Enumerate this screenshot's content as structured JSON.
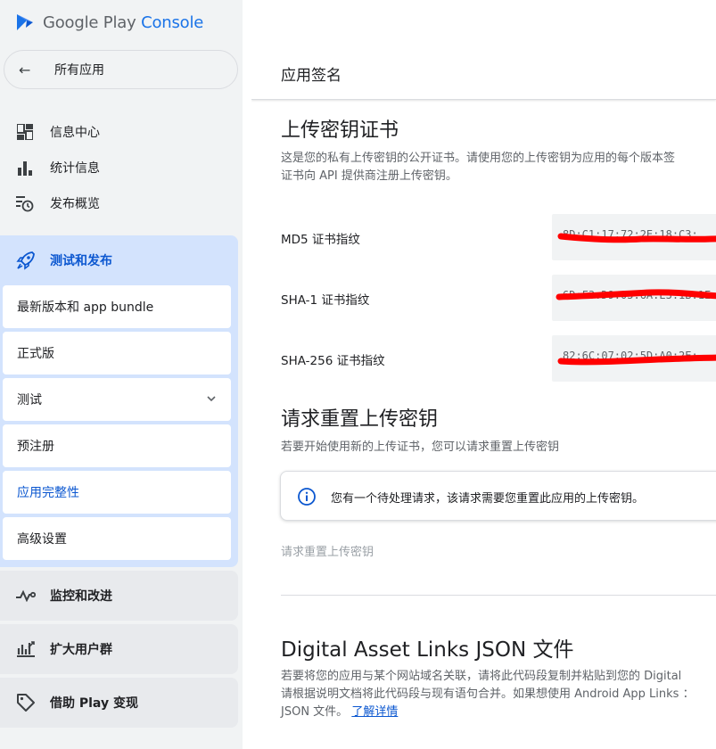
{
  "app": {
    "logo_google_play": "Google Play",
    "logo_console": "Console"
  },
  "sidebar": {
    "back_label": "所有应用",
    "items": [
      {
        "label": "信息中心",
        "icon": "dashboard-icon"
      },
      {
        "label": "统计信息",
        "icon": "bar-chart-icon"
      },
      {
        "label": "发布概览",
        "icon": "publishing-overview-icon"
      }
    ],
    "active_group": {
      "label": "测试和发布",
      "icon": "rocket-icon",
      "sub_items": [
        {
          "label": "最新版本和 app bundle"
        },
        {
          "label": "正式版"
        },
        {
          "label": "测试",
          "expandable": true
        },
        {
          "label": "预注册"
        },
        {
          "label": "应用完整性",
          "selected": true
        },
        {
          "label": "高级设置"
        }
      ]
    },
    "groups": [
      {
        "label": "监控和改进",
        "icon": "vitals-icon"
      },
      {
        "label": "扩大用户群",
        "icon": "grow-users-icon"
      },
      {
        "label": "借助 Play 变现",
        "icon": "monetize-tag-icon"
      }
    ]
  },
  "main": {
    "page_title": "应用签名",
    "upload_key": {
      "heading": "上传密钥证书",
      "desc_line1": "这是您的私有上传密钥的公开证书。请使用您的上传密钥为应用的每个版本签",
      "desc_line2": "证书向 API 提供商注册上传密钥。",
      "fingerprints": [
        {
          "label": "MD5 证书指纹",
          "value": "8D:C1:17:72:2E:18:C3:"
        },
        {
          "label": "SHA-1 证书指纹",
          "value": "6D:F3:D9:05:6A:E3:1B:1E:"
        },
        {
          "label": "SHA-256 证书指纹",
          "value": "82:6C:07:02:5D:A0:2E:"
        }
      ]
    },
    "reset": {
      "heading": "请求重置上传密钥",
      "desc": "若要开始使用新的上传证书，您可以请求重置上传密钥",
      "alert_text": "您有一个待处理请求，该请求需要您重置此应用的上传密钥。",
      "button_label": "请求重置上传密钥"
    },
    "asset_links": {
      "heading": "Digital Asset Links JSON 文件",
      "desc_line1": "若要将您的应用与某个网站域名关联，请将此代码段复制并粘贴到您的 Digital",
      "desc_line2": "请根据说明文档将此代码段与现有语句合并。如果想使用 Android App Links ：",
      "desc_line3_prefix": "JSON 文件。",
      "learn_more": "了解详情"
    }
  },
  "colors": {
    "accent": "#0b57d0",
    "active_group_bg": "#d3e3fd",
    "redaction": "#ff0000"
  }
}
